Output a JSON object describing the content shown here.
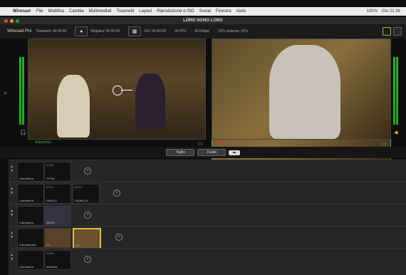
{
  "menubar": {
    "app": "Wirecast",
    "items": [
      "File",
      "Modifica",
      "Cambia",
      "Multimediali",
      "Trasmetti",
      "Layout",
      "Riproduzione e ISO",
      "Social",
      "Finestra",
      "Aiuto"
    ],
    "battery": "100%",
    "clock": "Gio 21:36"
  },
  "window": {
    "title": "LORO SONO LORO"
  },
  "toolbar": {
    "logo": "Wirecast Pro",
    "stream": "Trasmetti: 00:00:00",
    "record": "Registra: 00:00:00",
    "iso": "ISO: 00:00:00",
    "fps": "30 FPS",
    "kbps": "814 kbps",
    "cpu": "CPU sistema: 15%"
  },
  "preview": {
    "label": "Anteprima"
  },
  "live": {
    "label": "Diretta"
  },
  "transition": {
    "cut": "Taglio",
    "smooth": "Fluido",
    "go": "➡ "
  },
  "layers": [
    {
      "shots": [
        {
          "name": "Cancella liv",
          "time": ""
        },
        {
          "name": "TITOLI",
          "time": "00:25"
        }
      ]
    },
    {
      "shots": [
        {
          "name": "Cancella liv",
          "time": ""
        },
        {
          "name": "DANILO",
          "time": "00:10"
        },
        {
          "name": "ISABELLA",
          "time": "00:10"
        }
      ]
    },
    {
      "shots": [
        {
          "name": "Cancella liv",
          "time": ""
        },
        {
          "name": "INIZIO",
          "time": ""
        }
      ]
    },
    {
      "shots": [
        {
          "name": "Cancella livel",
          "time": ""
        },
        {
          "name": "C1",
          "time": ""
        },
        {
          "name": "C3",
          "time": ""
        }
      ]
    },
    {
      "shots": [
        {
          "name": "Cancella liv",
          "time": ""
        },
        {
          "name": "MUSICA",
          "time": "03:29"
        }
      ]
    }
  ]
}
